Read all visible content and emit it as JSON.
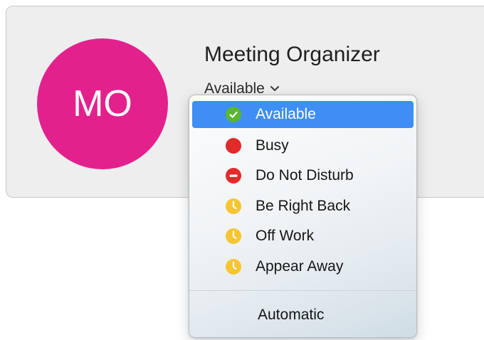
{
  "profile": {
    "initials": "MO",
    "name": "Meeting Organizer",
    "current_status": "Available",
    "avatar_color": "#e3218d"
  },
  "status_menu": {
    "selected_index": 0,
    "items": [
      {
        "label": "Available",
        "icon": "available-check-icon",
        "color": "#5bb531"
      },
      {
        "label": "Busy",
        "icon": "busy-dot-icon",
        "color": "#e12b2b"
      },
      {
        "label": "Do Not Disturb",
        "icon": "do-not-disturb-icon",
        "color": "#e12b2b"
      },
      {
        "label": "Be Right Back",
        "icon": "clock-icon",
        "color": "#f7c531"
      },
      {
        "label": "Off Work",
        "icon": "clock-icon",
        "color": "#f7c531"
      },
      {
        "label": "Appear Away",
        "icon": "clock-icon",
        "color": "#f7c531"
      }
    ],
    "automatic_label": "Automatic",
    "highlight_color": "#3e8ef5"
  }
}
